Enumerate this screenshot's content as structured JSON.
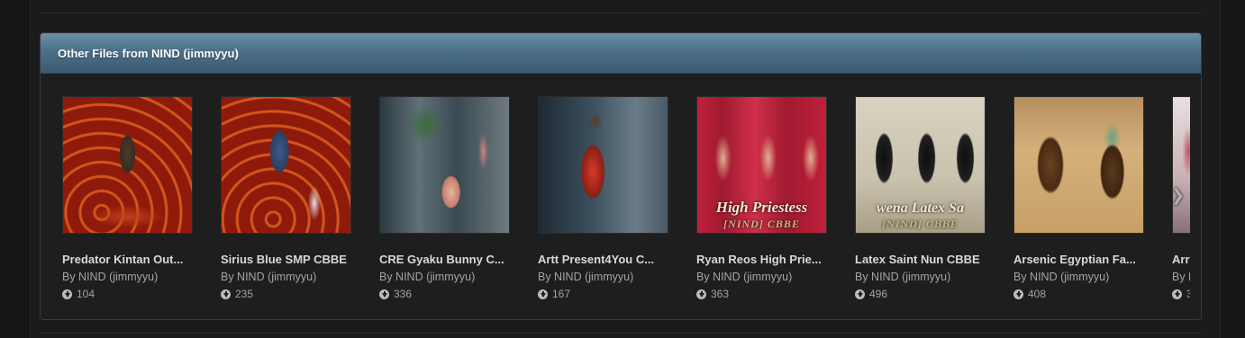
{
  "panel": {
    "title": "Other Files from NIND (jimmyyu)"
  },
  "files": [
    {
      "title": "Predator Kintan Out...",
      "author": "By NIND (jimmyyu)",
      "downloads": "104",
      "caption": ""
    },
    {
      "title": "Sirius Blue SMP CBBE",
      "author": "By NIND (jimmyyu)",
      "downloads": "235",
      "caption": ""
    },
    {
      "title": "CRE Gyaku Bunny C...",
      "author": "By NIND (jimmyyu)",
      "downloads": "336",
      "caption": ""
    },
    {
      "title": "Artt Present4You C...",
      "author": "By NIND (jimmyyu)",
      "downloads": "167",
      "caption": ""
    },
    {
      "title": "Ryan Reos High Prie...",
      "author": "By NIND (jimmyyu)",
      "downloads": "363",
      "caption": "High Priestess",
      "subcaption": "[NIND] CBBE"
    },
    {
      "title": "Latex Saint Nun CBBE",
      "author": "By NIND (jimmyyu)",
      "downloads": "496",
      "caption": "wena Latex Sa",
      "subcaption": "[NIND] CBBE"
    },
    {
      "title": "Arsenic Egyptian Fa...",
      "author": "By NIND (jimmyyu)",
      "downloads": "408",
      "caption": ""
    },
    {
      "title": "Arr",
      "author": "By N",
      "downloads": "3",
      "caption": ""
    }
  ],
  "icons": {
    "download": "download-icon",
    "next": "chevron-right-icon"
  },
  "colors": {
    "header_top": "#6b8faa",
    "header_bottom": "#3b5a72",
    "background": "#1b1b1b",
    "title_text": "#d8d8d8",
    "meta_text": "#a4a4a4"
  }
}
